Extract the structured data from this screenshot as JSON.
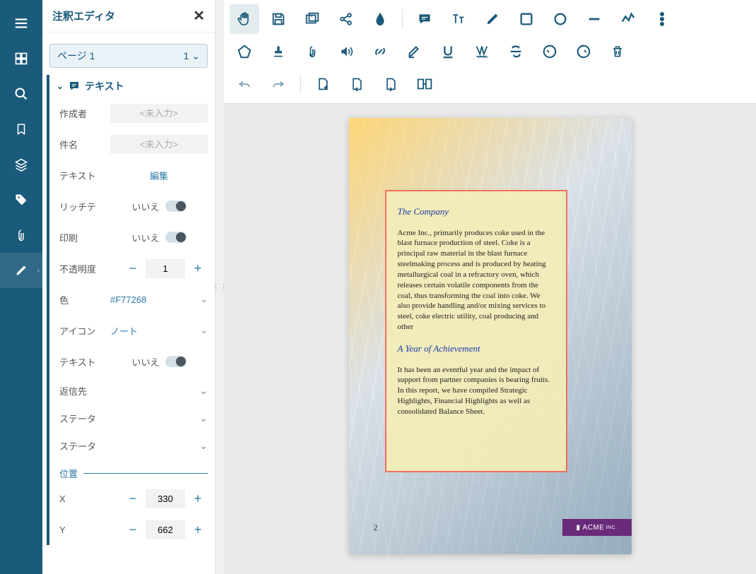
{
  "sidebar": {
    "title": "注釈エディタ",
    "pageLabel": "ページ 1",
    "pageNum": "1",
    "annoType": "テキスト",
    "props": {
      "author_lbl": "作成者",
      "author_ph": "<未入力>",
      "subject_lbl": "件名",
      "subject_ph": "<未入力>",
      "text_lbl": "テキスト",
      "text_val": "編集",
      "rich_lbl": "リッチテ",
      "rich_val": "いいえ",
      "print_lbl": "印刷",
      "print_val": "いいえ",
      "opacity_lbl": "不透明度",
      "opacity_val": "1",
      "color_lbl": "色",
      "color_val": "#F77268",
      "icon_lbl": "アイコン",
      "icon_val": "ノート",
      "textdir_lbl": "テキスト",
      "textdir_val": "いいえ",
      "reply_lbl": "返信先",
      "status1_lbl": "ステータ",
      "status2_lbl": "ステータ",
      "pos_lbl": "位置",
      "x_lbl": "X",
      "x_val": "330",
      "y_lbl": "Y",
      "y_val": "662"
    }
  },
  "doc": {
    "h1": "The Company",
    "p1": "Acme Inc., primarily produces coke used in the blast furnace production of steel. Coke is a principal raw material in the blast furnace steelmaking process and is produced by heating metallurgical coal in a refractory oven, which releases certain volatile components from the coal, thus transforming the coal into coke. We also provide handling and/or mixing services to steel, coke electric utility, coal producing and other",
    "h2": "A Year of Achievement",
    "p2": "It has been an eventful year and the impact of support from partner companies is bearing fruits. In this report, we have compiled Strategic Highlights, Financial Highlights as well as consolidated Balance Sheet.",
    "pagenum": "2",
    "logo": "ACME",
    "logo_suffix": "INC."
  }
}
